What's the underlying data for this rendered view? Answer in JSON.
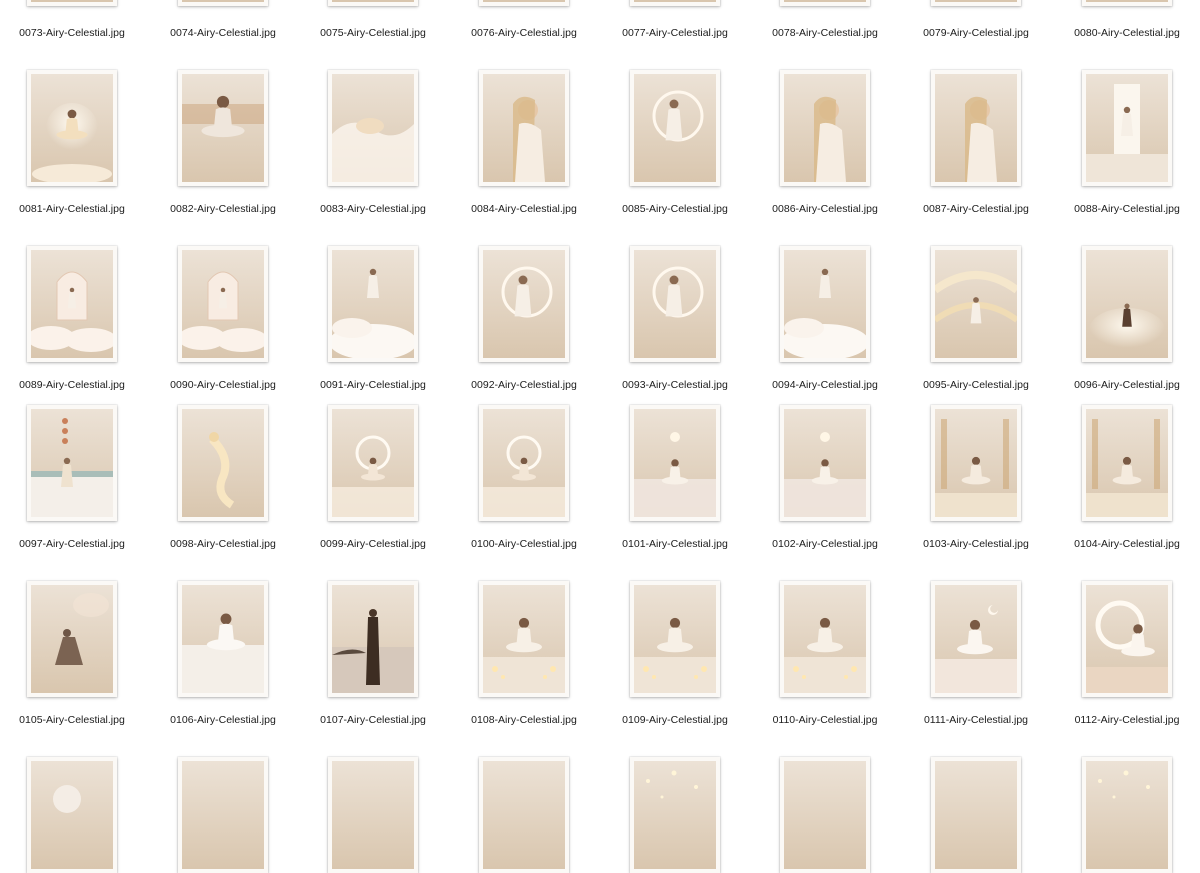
{
  "files": [
    {
      "name": "0073-Airy-Celestial.jpg",
      "icon": "image-file-icon",
      "palette": [
        "#ece2d6",
        "#d9c6ae"
      ],
      "motif": "none",
      "partial": "top"
    },
    {
      "name": "0074-Airy-Celestial.jpg",
      "icon": "image-file-icon",
      "palette": [
        "#e8d6c0",
        "#c9ac8a"
      ],
      "motif": "none",
      "partial": "top"
    },
    {
      "name": "0075-Airy-Celestial.jpg",
      "icon": "image-file-icon",
      "palette": [
        "#e6d2b8",
        "#cfa979"
      ],
      "motif": "none",
      "partial": "top"
    },
    {
      "name": "0076-Airy-Celestial.jpg",
      "icon": "image-file-icon",
      "palette": [
        "#e0dbd6",
        "#bdb5ad"
      ],
      "motif": "none",
      "partial": "top"
    },
    {
      "name": "0077-Airy-Celestial.jpg",
      "icon": "image-file-icon",
      "palette": [
        "#efe6da",
        "#dcc9b0"
      ],
      "motif": "none",
      "partial": "top"
    },
    {
      "name": "0078-Airy-Celestial.jpg",
      "icon": "image-file-icon",
      "palette": [
        "#ead9c4",
        "#cdb190"
      ],
      "motif": "none",
      "partial": "top"
    },
    {
      "name": "0079-Airy-Celestial.jpg",
      "icon": "image-file-icon",
      "palette": [
        "#ede0cc",
        "#d4bc98"
      ],
      "motif": "none",
      "partial": "top"
    },
    {
      "name": "0080-Airy-Celestial.jpg",
      "icon": "image-file-icon",
      "palette": [
        "#eee3d4",
        "#d8c4a8"
      ],
      "motif": "none",
      "partial": "top"
    },
    {
      "name": "0081-Airy-Celestial.jpg",
      "icon": "image-file-icon",
      "palette": [
        "#f2e6d6",
        "#e3c9a4"
      ],
      "motif": "meditate-glow"
    },
    {
      "name": "0082-Airy-Celestial.jpg",
      "icon": "image-file-icon",
      "palette": [
        "#d9b48e",
        "#a8825e"
      ],
      "motif": "meditate"
    },
    {
      "name": "0083-Airy-Celestial.jpg",
      "icon": "image-file-icon",
      "palette": [
        "#f4eadf",
        "#e3d3c1"
      ],
      "motif": "silk"
    },
    {
      "name": "0084-Airy-Celestial.jpg",
      "icon": "image-file-icon",
      "palette": [
        "#ecd9c4",
        "#d2b694"
      ],
      "motif": "portrait"
    },
    {
      "name": "0085-Airy-Celestial.jpg",
      "icon": "image-file-icon",
      "palette": [
        "#eedfce",
        "#d8bfa2"
      ],
      "motif": "moon-figure"
    },
    {
      "name": "0086-Airy-Celestial.jpg",
      "icon": "image-file-icon",
      "palette": [
        "#e6d6c4",
        "#cdb496"
      ],
      "motif": "portrait"
    },
    {
      "name": "0087-Airy-Celestial.jpg",
      "icon": "image-file-icon",
      "palette": [
        "#f0dcb8",
        "#ddb57a"
      ],
      "motif": "portrait"
    },
    {
      "name": "0088-Airy-Celestial.jpg",
      "icon": "image-file-icon",
      "palette": [
        "#e3d6c8",
        "#bba58d"
      ],
      "motif": "door"
    },
    {
      "name": "0089-Airy-Celestial.jpg",
      "icon": "image-file-icon",
      "palette": [
        "#f1dfd2",
        "#ddbfa9"
      ],
      "motif": "arch-clouds"
    },
    {
      "name": "0090-Airy-Celestial.jpg",
      "icon": "image-file-icon",
      "palette": [
        "#efdccd",
        "#d8b99f"
      ],
      "motif": "arch-clouds"
    },
    {
      "name": "0091-Airy-Celestial.jpg",
      "icon": "image-file-icon",
      "palette": [
        "#f5efe9",
        "#e6dbd0"
      ],
      "motif": "standing-clouds"
    },
    {
      "name": "0092-Airy-Celestial.jpg",
      "icon": "image-file-icon",
      "palette": [
        "#eddccb",
        "#d5bb9e"
      ],
      "motif": "moon-figure"
    },
    {
      "name": "0093-Airy-Celestial.jpg",
      "icon": "image-file-icon",
      "palette": [
        "#ebdccc",
        "#d2baa0"
      ],
      "motif": "moon-figure"
    },
    {
      "name": "0094-Airy-Celestial.jpg",
      "icon": "image-file-icon",
      "palette": [
        "#ecd8c6",
        "#d4b698"
      ],
      "motif": "standing-clouds"
    },
    {
      "name": "0095-Airy-Celestial.jpg",
      "icon": "image-file-icon",
      "palette": [
        "#e2c59c",
        "#c49a62"
      ],
      "motif": "swirl"
    },
    {
      "name": "0096-Airy-Celestial.jpg",
      "icon": "image-file-icon",
      "palette": [
        "#e8d1b0",
        "#caa476"
      ],
      "motif": "standing-glow"
    },
    {
      "name": "0097-Airy-Celestial.jpg",
      "icon": "image-file-icon",
      "palette": [
        "#d6d2ce",
        "#b9b2ab"
      ],
      "motif": "dancer"
    },
    {
      "name": "0098-Airy-Celestial.jpg",
      "icon": "image-file-icon",
      "palette": [
        "#f1dfc2",
        "#e0c08e"
      ],
      "motif": "mermaid"
    },
    {
      "name": "0099-Airy-Celestial.jpg",
      "icon": "image-file-icon",
      "palette": [
        "#eee2d4",
        "#d9c5ad"
      ],
      "motif": "moon-sit"
    },
    {
      "name": "0100-Airy-Celestial.jpg",
      "icon": "image-file-icon",
      "palette": [
        "#efe3d3",
        "#dcc6ab"
      ],
      "motif": "moon-sit"
    },
    {
      "name": "0101-Airy-Celestial.jpg",
      "icon": "image-file-icon",
      "palette": [
        "#d8d3e0",
        "#c6b6ae"
      ],
      "motif": "meditate-sky"
    },
    {
      "name": "0102-Airy-Celestial.jpg",
      "icon": "image-file-icon",
      "palette": [
        "#e4d3c4",
        "#c6ab92"
      ],
      "motif": "meditate-sky"
    },
    {
      "name": "0103-Airy-Celestial.jpg",
      "icon": "image-file-icon",
      "palette": [
        "#e2c79c",
        "#b99462"
      ],
      "motif": "meditate-trees"
    },
    {
      "name": "0104-Airy-Celestial.jpg",
      "icon": "image-file-icon",
      "palette": [
        "#ebdcc8",
        "#cfb698"
      ],
      "motif": "meditate-trees"
    },
    {
      "name": "0105-Airy-Celestial.jpg",
      "icon": "image-file-icon",
      "palette": [
        "#d8c6b6",
        "#b49d89"
      ],
      "motif": "silhouette"
    },
    {
      "name": "0106-Airy-Celestial.jpg",
      "icon": "image-file-icon",
      "palette": [
        "#f2ece4",
        "#ddd1c3"
      ],
      "motif": "sit-white"
    },
    {
      "name": "0107-Airy-Celestial.jpg",
      "icon": "image-file-icon",
      "palette": [
        "#c9b19a",
        "#8e7764"
      ],
      "motif": "back-beach"
    },
    {
      "name": "0108-Airy-Celestial.jpg",
      "icon": "image-file-icon",
      "palette": [
        "#d9b48c",
        "#9c7656"
      ],
      "motif": "candles"
    },
    {
      "name": "0109-Airy-Celestial.jpg",
      "icon": "image-file-icon",
      "palette": [
        "#dcb793",
        "#a47d5c"
      ],
      "motif": "candles"
    },
    {
      "name": "0110-Airy-Celestial.jpg",
      "icon": "image-file-icon",
      "palette": [
        "#cfc4bd",
        "#9e8f86"
      ],
      "motif": "candles"
    },
    {
      "name": "0111-Airy-Celestial.jpg",
      "icon": "image-file-icon",
      "palette": [
        "#ecdcd0",
        "#d2b9a6"
      ],
      "motif": "sit-moon-small"
    },
    {
      "name": "0112-Airy-Celestial.jpg",
      "icon": "image-file-icon",
      "palette": [
        "#f1e5d8",
        "#dcc6ae"
      ],
      "motif": "moon-sit-big"
    },
    {
      "name": "",
      "icon": "image-file-icon",
      "palette": [
        "#e6dbd0",
        "#cfc0b0"
      ],
      "motif": "moon-orb",
      "partial": "bottom"
    },
    {
      "name": "",
      "icon": "image-file-icon",
      "palette": [
        "#ebe2d8",
        "#d9cbbb"
      ],
      "motif": "none",
      "partial": "bottom"
    },
    {
      "name": "",
      "icon": "image-file-icon",
      "palette": [
        "#ece1d5",
        "#d7c6b3"
      ],
      "motif": "none",
      "partial": "bottom"
    },
    {
      "name": "",
      "icon": "image-file-icon",
      "palette": [
        "#e2dcd8",
        "#c7bfb8"
      ],
      "motif": "none",
      "partial": "bottom"
    },
    {
      "name": "",
      "icon": "image-file-icon",
      "palette": [
        "#e8cc9c",
        "#c9a063"
      ],
      "motif": "sparkle",
      "partial": "bottom"
    },
    {
      "name": "",
      "icon": "image-file-icon",
      "palette": [
        "#eee6dd",
        "#dcd0c3"
      ],
      "motif": "none",
      "partial": "bottom"
    },
    {
      "name": "",
      "icon": "image-file-icon",
      "palette": [
        "#d8bd98",
        "#b6966c"
      ],
      "motif": "none",
      "partial": "bottom"
    },
    {
      "name": "",
      "icon": "image-file-icon",
      "palette": [
        "#ecd6b0",
        "#d1b27e"
      ],
      "motif": "sparkle",
      "partial": "bottom"
    }
  ]
}
